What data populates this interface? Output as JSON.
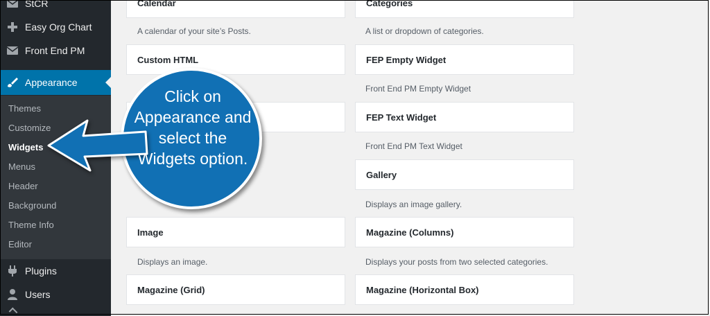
{
  "sidebar": {
    "top_items": [
      {
        "label": "StCR",
        "icon": "mail-icon"
      },
      {
        "label": "Easy Org Chart",
        "icon": "plus-icon"
      },
      {
        "label": "Front End PM",
        "icon": "mail-icon"
      }
    ],
    "current": {
      "label": "Appearance",
      "icon": "paintbrush-icon"
    },
    "submenu": [
      "Themes",
      "Customize",
      "Widgets",
      "Menus",
      "Header",
      "Background",
      "Theme Info",
      "Editor"
    ],
    "active_submenu": "Widgets",
    "bottom_items": [
      {
        "label": "Plugins",
        "icon": "plug-icon"
      },
      {
        "label": "Users",
        "icon": "user-icon"
      }
    ]
  },
  "widgets": {
    "left": [
      {
        "title": "Calendar",
        "desc": "A calendar of your site’s Posts."
      },
      {
        "title": "Custom HTML",
        "desc": ""
      },
      {
        "title": "",
        "desc": ""
      },
      {
        "title": "Image",
        "desc": "Displays an image."
      },
      {
        "title": "Magazine (Grid)",
        "desc": ""
      }
    ],
    "right": [
      {
        "title": "Categories",
        "desc": "A list or dropdown of categories."
      },
      {
        "title": "FEP Empty Widget",
        "desc": "Front End PM Empty Widget"
      },
      {
        "title": "FEP Text Widget",
        "desc": "Front End PM Text Widget"
      },
      {
        "title": "Gallery",
        "desc": "Displays an image gallery."
      },
      {
        "title": "Magazine (Columns)",
        "desc": "Displays your posts from two selected categories."
      },
      {
        "title": "Magazine (Horizontal Box)",
        "desc": ""
      }
    ]
  },
  "callout": {
    "lines": [
      "Click on",
      "Appearance and",
      "select the",
      "Widgets option."
    ]
  },
  "colors": {
    "sidebar_bg": "#23282d",
    "submenu_bg": "#32373c",
    "accent": "#0073aa",
    "callout": "#1170b4"
  }
}
